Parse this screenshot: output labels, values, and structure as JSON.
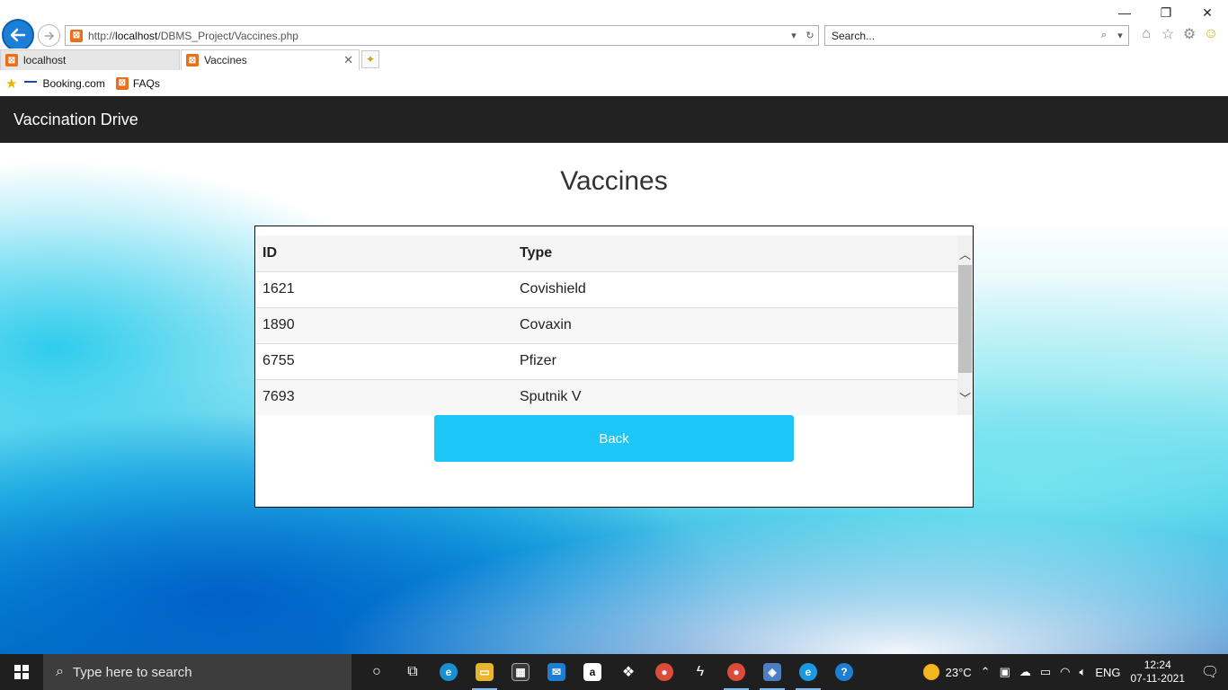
{
  "browser": {
    "url_prefix": "http://",
    "url_host": "localhost",
    "url_path": "/DBMS_Project/Vaccines.php",
    "search_placeholder": "Search...",
    "tabs": [
      {
        "label": "localhost"
      },
      {
        "label": "Vaccines"
      }
    ],
    "favorites": [
      {
        "label": "Booking.com"
      },
      {
        "label": "FAQs"
      }
    ]
  },
  "navbar": {
    "brand": "Vaccination Drive"
  },
  "page": {
    "title": "Vaccines",
    "table": {
      "headers": [
        "ID",
        "Type"
      ],
      "rows": [
        {
          "id": "1621",
          "type": "Covishield"
        },
        {
          "id": "1890",
          "type": "Covaxin"
        },
        {
          "id": "6755",
          "type": "Pfizer"
        },
        {
          "id": "7693",
          "type": "Sputnik V"
        }
      ]
    },
    "back_button": "Back"
  },
  "taskbar": {
    "search_placeholder": "Type here to search",
    "weather": "23°C",
    "language": "ENG",
    "time": "12:24",
    "date": "07-11-2021"
  },
  "colors": {
    "navbar_bg": "#222222",
    "back_button_bg": "#1cc7f7",
    "browser_back": "#1c7ed6",
    "xampp": "#e8701a"
  }
}
